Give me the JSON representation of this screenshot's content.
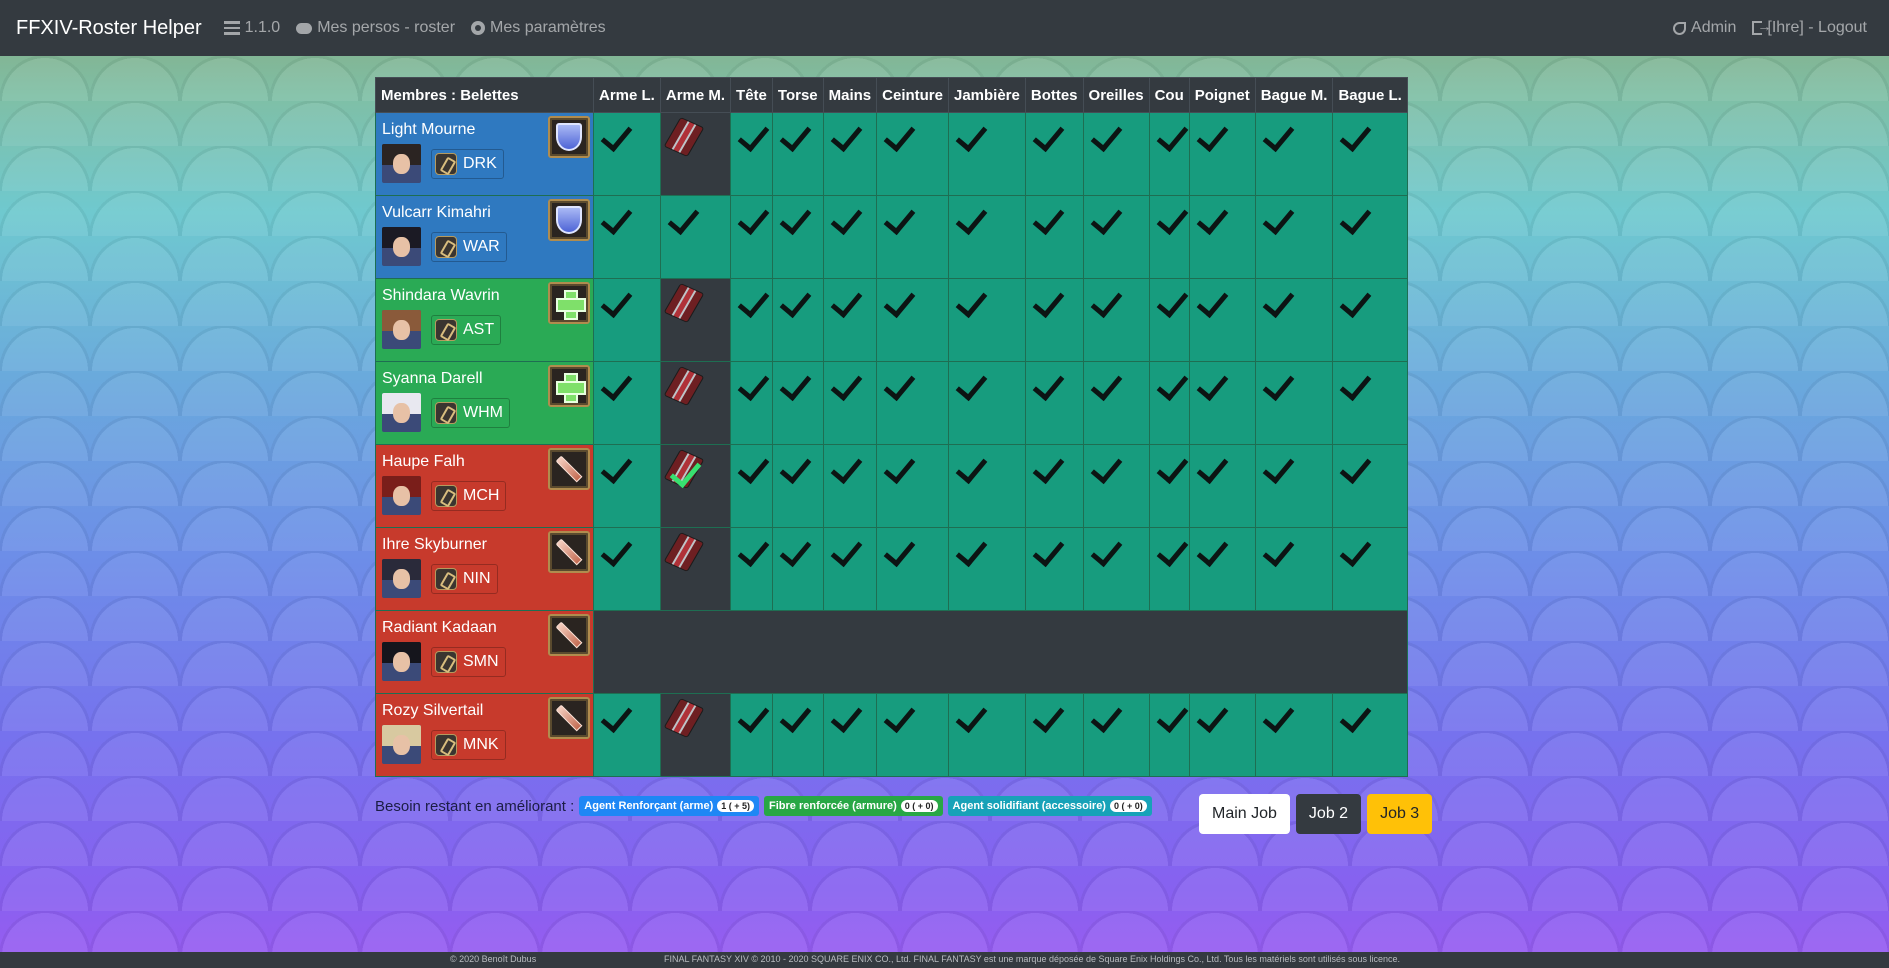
{
  "navbar": {
    "brand": "FFXIV-Roster Helper",
    "version": "1.1.0",
    "mes_persos": "Mes persos - roster",
    "mes_parametres": "Mes paramètres",
    "admin": "Admin",
    "logout": "[Ihre] - Logout"
  },
  "table": {
    "headers": [
      "Membres : Belettes",
      "Arme L.",
      "Arme M.",
      "Tête",
      "Torse",
      "Mains",
      "Ceinture",
      "Jambière",
      "Bottes",
      "Oreilles",
      "Cou",
      "Poignet",
      "Bague M.",
      "Bague L."
    ],
    "rows": [
      {
        "name": "Light Mourne",
        "job": "DRK",
        "role": "tank",
        "portrait": {
          "hair": "#2b2422"
        },
        "cells": [
          "ok",
          "token",
          "ok",
          "ok",
          "ok",
          "ok",
          "ok",
          "ok",
          "ok",
          "ok",
          "ok",
          "ok",
          "ok"
        ]
      },
      {
        "name": "Vulcarr Kimahri",
        "job": "WAR",
        "role": "tank",
        "portrait": {
          "hair": "#1b1a24"
        },
        "cells": [
          "ok",
          "ok",
          "ok",
          "ok",
          "ok",
          "ok",
          "ok",
          "ok",
          "ok",
          "ok",
          "ok",
          "ok",
          "ok"
        ]
      },
      {
        "name": "Shindara Wavrin",
        "job": "AST",
        "role": "healer",
        "portrait": {
          "hair": "#8a5a3a"
        },
        "cells": [
          "ok",
          "token",
          "ok",
          "ok",
          "ok",
          "ok",
          "ok",
          "ok",
          "ok",
          "ok",
          "ok",
          "ok",
          "ok"
        ]
      },
      {
        "name": "Syanna Darell",
        "job": "WHM",
        "role": "healer",
        "portrait": {
          "hair": "#e8e8f0"
        },
        "cells": [
          "ok",
          "token",
          "ok",
          "ok",
          "ok",
          "ok",
          "ok",
          "ok",
          "ok",
          "ok",
          "ok",
          "ok",
          "ok"
        ]
      },
      {
        "name": "Haupe Falh",
        "job": "MCH",
        "role": "dps",
        "portrait": {
          "hair": "#7a1e1a"
        },
        "cells": [
          "ok",
          "token-green",
          "ok",
          "ok",
          "ok",
          "ok",
          "ok",
          "ok",
          "ok",
          "ok",
          "ok",
          "ok",
          "ok"
        ]
      },
      {
        "name": "Ihre Skyburner",
        "job": "NIN",
        "role": "dps",
        "portrait": {
          "hair": "#2a2a3a"
        },
        "cells": [
          "ok",
          "token",
          "ok",
          "ok",
          "ok",
          "ok",
          "ok",
          "ok",
          "ok",
          "ok",
          "ok",
          "ok",
          "ok"
        ]
      },
      {
        "name": "Radiant Kadaan",
        "job": "SMN",
        "role": "dps",
        "portrait": {
          "hair": "#15151c"
        },
        "cells": []
      },
      {
        "name": "Rozy Silvertail",
        "job": "MNK",
        "role": "dps",
        "portrait": {
          "hair": "#d8c9a0"
        },
        "cells": [
          "ok",
          "token",
          "ok",
          "ok",
          "ok",
          "ok",
          "ok",
          "ok",
          "ok",
          "ok",
          "ok",
          "ok",
          "ok"
        ]
      }
    ]
  },
  "needs": {
    "label": "Besoin restant en améliorant :",
    "badges": [
      {
        "label": "Agent Renforçant (arme)",
        "count": "1 ( + 5)",
        "color": "#1e87f5"
      },
      {
        "label": "Fibre renforcée (armure)",
        "count": "0 ( + 0)",
        "color": "#28a745"
      },
      {
        "label": "Agent solidifiant (accessoire)",
        "count": "0 ( + 0)",
        "color": "#17a2b8"
      }
    ]
  },
  "job_buttons": [
    "Main Job",
    "Job 2",
    "Job 3"
  ],
  "footer": {
    "left": "© 2020 Benoît Dubus",
    "right": "FINAL FANTASY XIV © 2010 - 2020 SQUARE ENIX CO., Ltd. FINAL FANTASY est une marque déposée de Square Enix Holdings Co., Ltd. Tous les matériels sont utilisés sous licence."
  }
}
